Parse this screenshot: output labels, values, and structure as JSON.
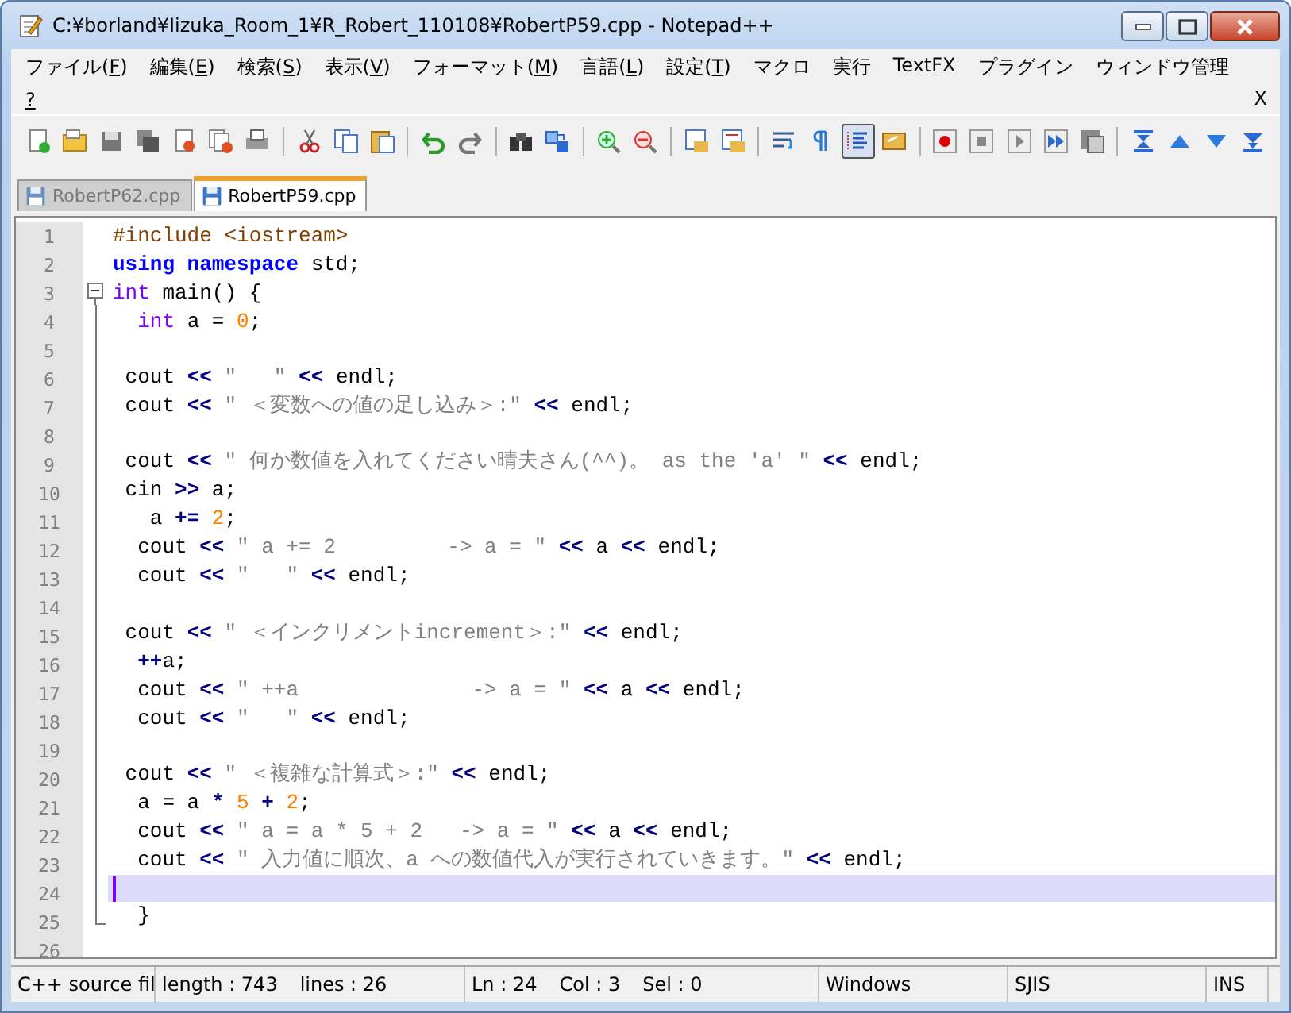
{
  "window": {
    "title": "C:¥borland¥Iizuka_Room_1¥R_Robert_110108¥RobertP59.cpp - Notepad++"
  },
  "menu": [
    {
      "label": "ファイル(",
      "key": "F",
      "suffix": ")"
    },
    {
      "label": "編集(",
      "key": "E",
      "suffix": ")"
    },
    {
      "label": "検索(",
      "key": "S",
      "suffix": ")"
    },
    {
      "label": "表示(",
      "key": "V",
      "suffix": ")"
    },
    {
      "label": "フォーマット(",
      "key": "M",
      "suffix": ")"
    },
    {
      "label": "言語(",
      "key": "L",
      "suffix": ")"
    },
    {
      "label": "設定(",
      "key": "T",
      "suffix": ")"
    },
    {
      "label": "マクロ"
    },
    {
      "label": "実行"
    },
    {
      "label": "TextFX"
    },
    {
      "label": "プラグイン"
    },
    {
      "label": "ウィンドウ管理"
    },
    {
      "key": "?"
    }
  ],
  "document_close": "X",
  "toolbar": [
    {
      "kind": "new",
      "pressed": false
    },
    {
      "kind": "open",
      "pressed": false
    },
    {
      "kind": "save",
      "pressed": false
    },
    {
      "kind": "save-all",
      "pressed": false
    },
    {
      "kind": "close",
      "pressed": false
    },
    {
      "kind": "close-all",
      "pressed": false
    },
    {
      "kind": "print",
      "pressed": false
    },
    {
      "kind": "separator"
    },
    {
      "kind": "cut",
      "pressed": false
    },
    {
      "kind": "copy",
      "pressed": false
    },
    {
      "kind": "paste",
      "pressed": false
    },
    {
      "kind": "separator"
    },
    {
      "kind": "undo",
      "pressed": false
    },
    {
      "kind": "redo",
      "pressed": false
    },
    {
      "kind": "separator"
    },
    {
      "kind": "find",
      "pressed": false
    },
    {
      "kind": "replace",
      "pressed": false
    },
    {
      "kind": "separator"
    },
    {
      "kind": "zoom-in",
      "pressed": false
    },
    {
      "kind": "zoom-out",
      "pressed": false
    },
    {
      "kind": "separator"
    },
    {
      "kind": "sync-vertical",
      "pressed": false
    },
    {
      "kind": "sync-horizontal",
      "pressed": false
    },
    {
      "kind": "separator"
    },
    {
      "kind": "wrap",
      "pressed": false
    },
    {
      "kind": "all-chars",
      "pressed": false
    },
    {
      "kind": "indent-guide",
      "pressed": true
    },
    {
      "kind": "user-language",
      "pressed": false
    },
    {
      "kind": "separator"
    },
    {
      "kind": "record",
      "pressed": false
    },
    {
      "kind": "stop",
      "pressed": false
    },
    {
      "kind": "play",
      "pressed": false
    },
    {
      "kind": "play-multiple",
      "pressed": false
    },
    {
      "kind": "save-macro",
      "pressed": false
    },
    {
      "kind": "separator"
    },
    {
      "kind": "fold-all",
      "pressed": false
    },
    {
      "kind": "up",
      "pressed": false
    },
    {
      "kind": "down",
      "pressed": false
    },
    {
      "kind": "unfold-all",
      "pressed": false
    }
  ],
  "tabs": [
    {
      "label": "RobertP62.cpp",
      "selected": false
    },
    {
      "label": "RobertP59.cpp",
      "selected": true
    }
  ],
  "editor": {
    "lines": [
      {
        "number": "1",
        "current": false,
        "kind": "plain",
        "tokens": [
          {
            "kind": "pre",
            "text": "#include <iostream>"
          }
        ]
      },
      {
        "number": "2",
        "current": false,
        "kind": "plain",
        "tokens": [
          {
            "kind": "kw",
            "text": "using namespace"
          },
          {
            "kind": "text",
            "text": " std;"
          }
        ]
      },
      {
        "number": "3",
        "current": false,
        "kind": "fold-start",
        "tokens": [
          {
            "kind": "type",
            "text": "int"
          },
          {
            "kind": "text",
            "text": " main() {"
          }
        ]
      },
      {
        "number": "4",
        "current": false,
        "kind": "folded",
        "tokens": [
          {
            "kind": "type",
            "text": "  int"
          },
          {
            "kind": "text",
            "text": " a = "
          },
          {
            "kind": "num",
            "text": "0"
          },
          {
            "kind": "text",
            "text": ";"
          }
        ]
      },
      {
        "number": "5",
        "current": false,
        "kind": "folded"
      },
      {
        "number": "6",
        "current": false,
        "kind": "folded",
        "tokens": [
          {
            "kind": "text",
            "text": " cout "
          },
          {
            "kind": "op",
            "text": "<<"
          },
          {
            "kind": "str",
            "text": " \"   \" "
          },
          {
            "kind": "op",
            "text": "<<"
          },
          {
            "kind": "text",
            "text": " endl;"
          }
        ]
      },
      {
        "number": "7",
        "current": false,
        "kind": "folded",
        "tokens": [
          {
            "kind": "text",
            "text": " cout "
          },
          {
            "kind": "op",
            "text": "<<"
          },
          {
            "kind": "str",
            "text": " \" ＜変数への値の足し込み＞:\" "
          },
          {
            "kind": "op",
            "text": "<<"
          },
          {
            "kind": "text",
            "text": " endl;"
          }
        ]
      },
      {
        "number": "8",
        "current": false,
        "kind": "folded"
      },
      {
        "number": "9",
        "current": false,
        "kind": "folded",
        "tokens": [
          {
            "kind": "text",
            "text": " cout "
          },
          {
            "kind": "op",
            "text": "<<"
          },
          {
            "kind": "str",
            "text": " \" 何か数値を入れてください晴夫さん(^^)。 as the 'a' \" "
          },
          {
            "kind": "op",
            "text": "<<"
          },
          {
            "kind": "text",
            "text": " endl;"
          }
        ]
      },
      {
        "number": "10",
        "current": false,
        "kind": "folded",
        "tokens": [
          {
            "kind": "text",
            "text": " cin "
          },
          {
            "kind": "op",
            "text": ">>"
          },
          {
            "kind": "text",
            "text": " a;"
          }
        ]
      },
      {
        "number": "11",
        "current": false,
        "kind": "folded",
        "tokens": [
          {
            "kind": "text",
            "text": "   a "
          },
          {
            "kind": "op",
            "text": "+="
          },
          {
            "kind": "num",
            "text": " 2"
          },
          {
            "kind": "text",
            "text": ";"
          }
        ]
      },
      {
        "number": "12",
        "current": false,
        "kind": "folded",
        "tokens": [
          {
            "kind": "text",
            "text": "  cout "
          },
          {
            "kind": "op",
            "text": "<<"
          },
          {
            "kind": "str",
            "text": " \" a += 2         -> a = \" "
          },
          {
            "kind": "op",
            "text": "<<"
          },
          {
            "kind": "text",
            "text": " a "
          },
          {
            "kind": "op",
            "text": "<<"
          },
          {
            "kind": "text",
            "text": " endl;"
          }
        ]
      },
      {
        "number": "13",
        "current": false,
        "kind": "folded",
        "tokens": [
          {
            "kind": "text",
            "text": "  cout "
          },
          {
            "kind": "op",
            "text": "<<"
          },
          {
            "kind": "str",
            "text": " \"   \" "
          },
          {
            "kind": "op",
            "text": "<<"
          },
          {
            "kind": "text",
            "text": " endl;"
          }
        ]
      },
      {
        "number": "14",
        "current": false,
        "kind": "folded"
      },
      {
        "number": "15",
        "current": false,
        "kind": "folded",
        "tokens": [
          {
            "kind": "text",
            "text": " cout "
          },
          {
            "kind": "op",
            "text": "<<"
          },
          {
            "kind": "str",
            "text": " \" ＜インクリメントincrement＞:\" "
          },
          {
            "kind": "op",
            "text": "<<"
          },
          {
            "kind": "text",
            "text": " endl;"
          }
        ]
      },
      {
        "number": "16",
        "current": false,
        "kind": "folded",
        "tokens": [
          {
            "kind": "op",
            "text": "  ++"
          },
          {
            "kind": "text",
            "text": "a;"
          }
        ]
      },
      {
        "number": "17",
        "current": false,
        "kind": "folded",
        "tokens": [
          {
            "kind": "text",
            "text": "  cout "
          },
          {
            "kind": "op",
            "text": "<<"
          },
          {
            "kind": "str",
            "text": " \" ++a              -> a = \" "
          },
          {
            "kind": "op",
            "text": "<<"
          },
          {
            "kind": "text",
            "text": " a "
          },
          {
            "kind": "op",
            "text": "<<"
          },
          {
            "kind": "text",
            "text": " endl;"
          }
        ]
      },
      {
        "number": "18",
        "current": false,
        "kind": "folded",
        "tokens": [
          {
            "kind": "text",
            "text": "  cout "
          },
          {
            "kind": "op",
            "text": "<<"
          },
          {
            "kind": "str",
            "text": " \"   \" "
          },
          {
            "kind": "op",
            "text": "<<"
          },
          {
            "kind": "text",
            "text": " endl;"
          }
        ]
      },
      {
        "number": "19",
        "current": false,
        "kind": "folded"
      },
      {
        "number": "20",
        "current": false,
        "kind": "folded",
        "tokens": [
          {
            "kind": "text",
            "text": " cout "
          },
          {
            "kind": "op",
            "text": "<<"
          },
          {
            "kind": "str",
            "text": " \" ＜複雑な計算式＞:\" "
          },
          {
            "kind": "op",
            "text": "<<"
          },
          {
            "kind": "text",
            "text": " endl;"
          }
        ]
      },
      {
        "number": "21",
        "current": false,
        "kind": "folded",
        "tokens": [
          {
            "kind": "text",
            "text": "  a = a "
          },
          {
            "kind": "op",
            "text": "*"
          },
          {
            "kind": "num",
            "text": " 5"
          },
          {
            "kind": "op",
            "text": " +"
          },
          {
            "kind": "num",
            "text": " 2"
          },
          {
            "kind": "text",
            "text": ";"
          }
        ]
      },
      {
        "number": "22",
        "current": false,
        "kind": "folded",
        "tokens": [
          {
            "kind": "text",
            "text": "  cout "
          },
          {
            "kind": "op",
            "text": "<<"
          },
          {
            "kind": "str",
            "text": " \" a = a * 5 + 2   -> a = \" "
          },
          {
            "kind": "op",
            "text": "<<"
          },
          {
            "kind": "text",
            "text": " a "
          },
          {
            "kind": "op",
            "text": "<<"
          },
          {
            "kind": "text",
            "text": " endl;"
          }
        ]
      },
      {
        "number": "23",
        "current": false,
        "kind": "folded",
        "tokens": [
          {
            "kind": "text",
            "text": "  cout "
          },
          {
            "kind": "op",
            "text": "<<"
          },
          {
            "kind": "str",
            "text": " \" 入力値に順次、a への数値代入が実行されていきます。\" "
          },
          {
            "kind": "op",
            "text": "<<"
          },
          {
            "kind": "text",
            "text": " endl;"
          }
        ]
      },
      {
        "number": "24",
        "current": true,
        "kind": "folded"
      },
      {
        "number": "25",
        "current": false,
        "kind": "fold-end",
        "tokens": [
          {
            "kind": "text",
            "text": "  }"
          }
        ]
      },
      {
        "number": "26",
        "current": false,
        "kind": "plain"
      }
    ]
  },
  "status_bar": [
    {
      "texts": [
        "C++ source fil"
      ]
    },
    {
      "texts": [
        "length : 743",
        "lines : 26"
      ]
    },
    {
      "texts": [
        "Ln : 24",
        "Col : 3",
        "Sel : 0"
      ]
    },
    {
      "texts": [
        "Windows"
      ]
    },
    {
      "texts": [
        "SJIS"
      ]
    },
    {
      "texts": [
        "INS"
      ]
    }
  ]
}
